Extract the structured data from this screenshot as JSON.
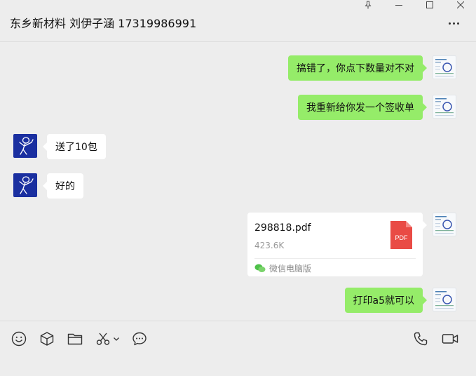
{
  "window": {
    "title": "东乡新材料 刘伊子涵 17319986991"
  },
  "messages": [
    {
      "sender": "self",
      "text": "搞错了，你点下数量对不对"
    },
    {
      "sender": "self",
      "text": "我重新给你发一个签收单"
    },
    {
      "sender": "contact",
      "text": "送了10包"
    },
    {
      "sender": "contact",
      "text": "好的"
    },
    {
      "sender": "self",
      "type": "file",
      "file_name": "298818.pdf",
      "file_size": "423.6K",
      "file_icon_label": "PDF",
      "source": "微信电脑版"
    },
    {
      "sender": "self",
      "text": "打印a5就可以"
    }
  ],
  "colors": {
    "self_bubble": "#95ec69",
    "contact_bubble": "#ffffff",
    "background": "#ededed",
    "pdf_red": "#e94b45"
  },
  "toolbar": {
    "left": [
      "emoji-icon",
      "sticker-box-icon",
      "folder-icon",
      "scissors-icon",
      "chevron-down-icon",
      "chat-history-icon"
    ],
    "right": [
      "phone-icon",
      "video-call-icon"
    ]
  }
}
